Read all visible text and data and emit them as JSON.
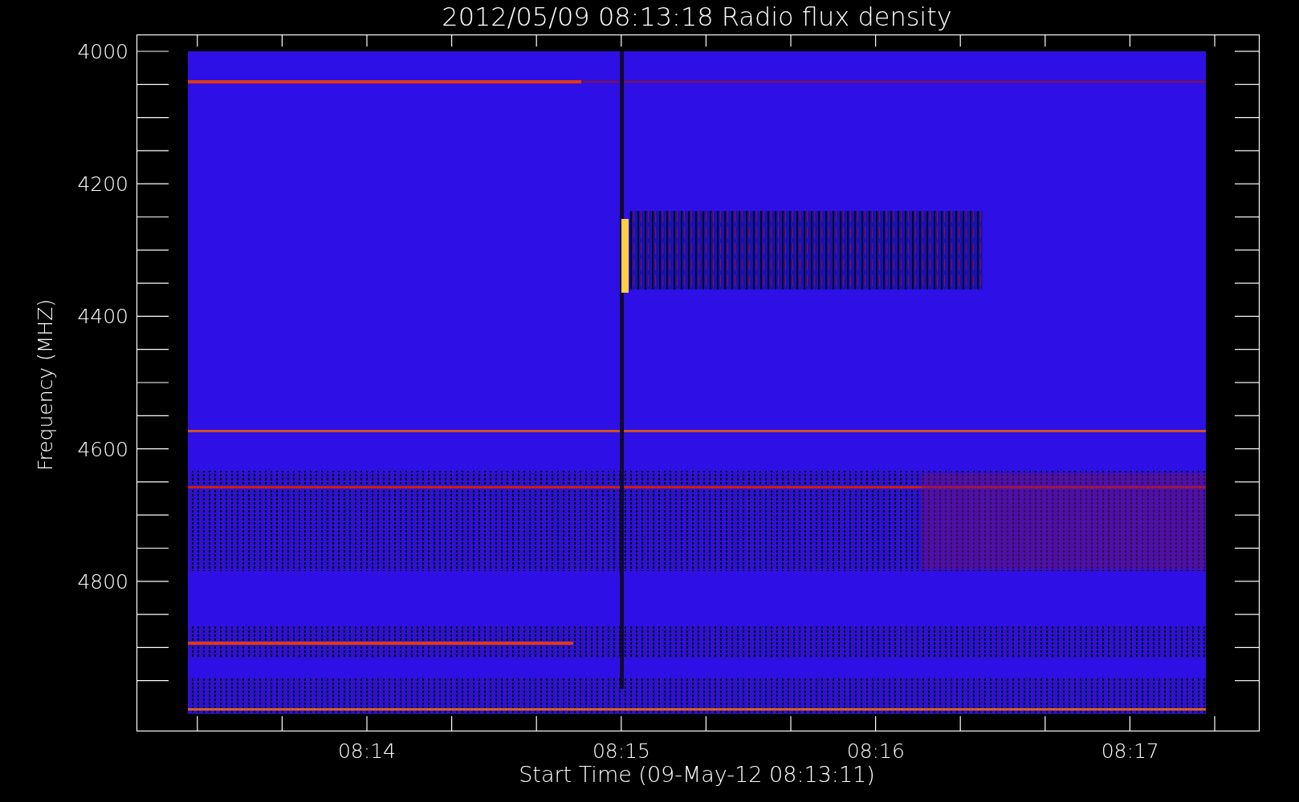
{
  "title": "2012/05/09 08:13:18 Radio flux density",
  "y_axis": {
    "label": "Frequency (MHZ)",
    "ticks": [
      "4000",
      "4200",
      "4400",
      "4600",
      "4800"
    ]
  },
  "x_axis": {
    "label": "Start Time (09-May-12 08:13:11)",
    "ticks": [
      "08:14",
      "08:15",
      "08:16",
      "08:17"
    ]
  }
}
